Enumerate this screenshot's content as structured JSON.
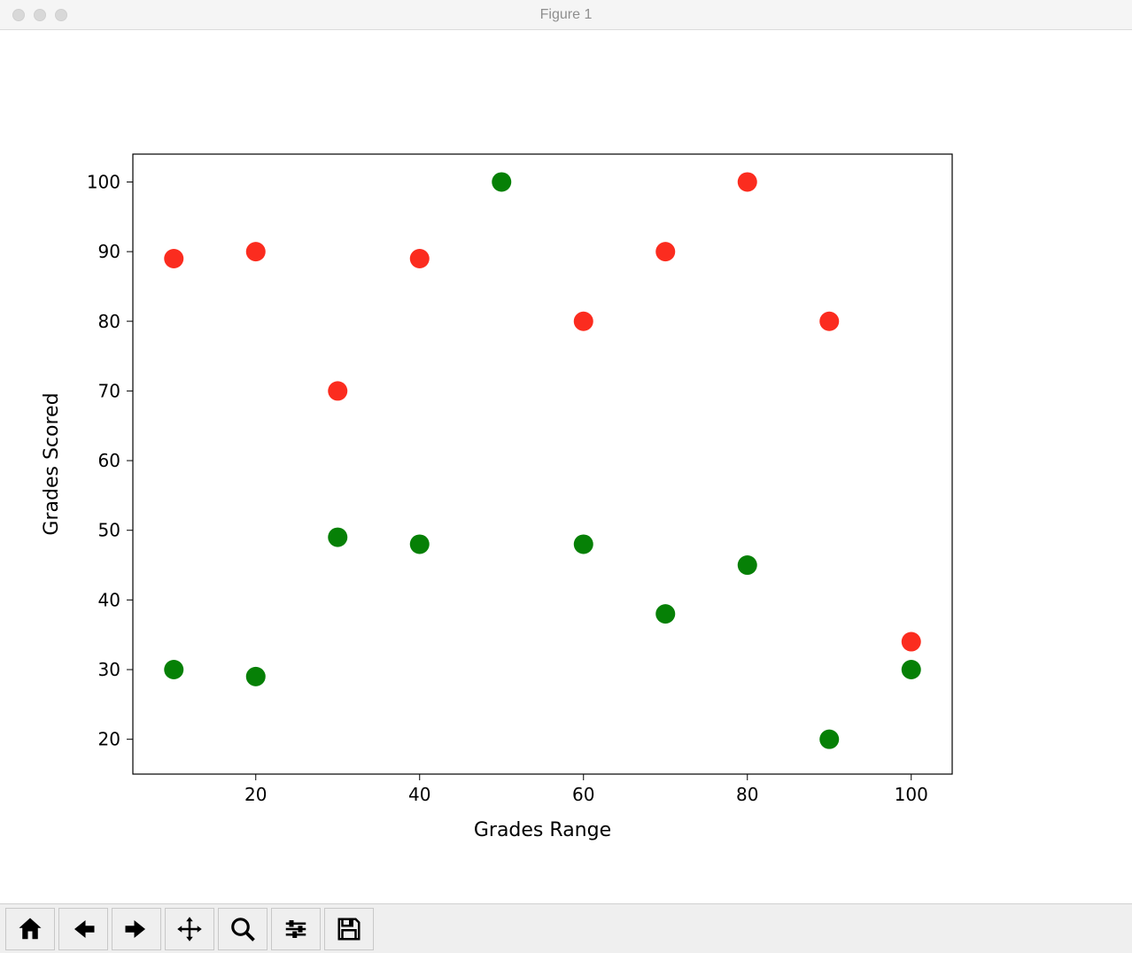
{
  "window": {
    "title": "Figure 1"
  },
  "toolbar": {
    "home": "home-icon",
    "back": "back-icon",
    "forward": "forward-icon",
    "pan": "pan-icon",
    "zoom": "zoom-icon",
    "configure": "configure-icon",
    "save": "save-icon"
  },
  "chart_data": {
    "type": "scatter",
    "xlabel": "Grades Range",
    "ylabel": "Grades Scored",
    "xlim": [
      5,
      105
    ],
    "ylim": [
      15,
      104
    ],
    "xticks": [
      20,
      40,
      60,
      80,
      100
    ],
    "yticks": [
      20,
      30,
      40,
      50,
      60,
      70,
      80,
      90,
      100
    ],
    "series": [
      {
        "name": "red",
        "color": "#fb2c1f",
        "points": [
          {
            "x": 10,
            "y": 89
          },
          {
            "x": 20,
            "y": 90
          },
          {
            "x": 30,
            "y": 70
          },
          {
            "x": 40,
            "y": 89
          },
          {
            "x": 60,
            "y": 80
          },
          {
            "x": 70,
            "y": 90
          },
          {
            "x": 80,
            "y": 100
          },
          {
            "x": 90,
            "y": 80
          },
          {
            "x": 100,
            "y": 34
          }
        ]
      },
      {
        "name": "green",
        "color": "#068006",
        "points": [
          {
            "x": 10,
            "y": 30
          },
          {
            "x": 20,
            "y": 29
          },
          {
            "x": 30,
            "y": 49
          },
          {
            "x": 40,
            "y": 48
          },
          {
            "x": 50,
            "y": 100
          },
          {
            "x": 60,
            "y": 48
          },
          {
            "x": 70,
            "y": 38
          },
          {
            "x": 80,
            "y": 45
          },
          {
            "x": 90,
            "y": 20
          },
          {
            "x": 100,
            "y": 30
          }
        ]
      }
    ]
  }
}
